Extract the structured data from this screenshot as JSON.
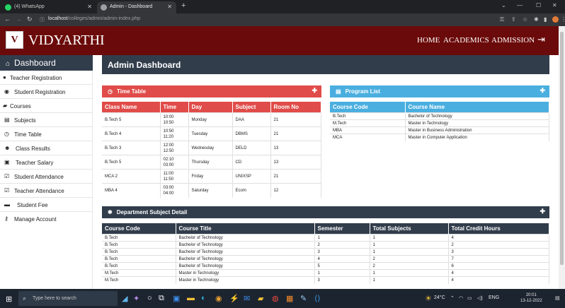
{
  "browser": {
    "tabs": [
      {
        "title": "(4) WhatsApp",
        "active": false
      },
      {
        "title": "Admin - Dashboard",
        "active": true
      }
    ],
    "new_tab": "+",
    "url_host": "localhost",
    "url_path": "/colleges/admin/admin-index.php",
    "window_controls": [
      "⌄",
      "—",
      "☐",
      "✕"
    ]
  },
  "header": {
    "logo_letter": "V",
    "brand": "VIDYARTHI",
    "nav": [
      "HOME",
      "ACADEMICS",
      "ADMISSION"
    ],
    "logout_icon": "sign-out-icon"
  },
  "sidebar": {
    "title": "Dashboard",
    "items": [
      {
        "label": "Teacher Registration",
        "icon": "user-icon"
      },
      {
        "label": "Student Registration",
        "icon": "user-circle-icon"
      },
      {
        "label": "Courses",
        "icon": "book-icon"
      },
      {
        "label": "Subjects",
        "icon": "file-icon"
      },
      {
        "label": "Time Table",
        "icon": "clock-icon"
      },
      {
        "label": "Class Results",
        "icon": "users-icon"
      },
      {
        "label": "Teacher Salary",
        "icon": "money-icon"
      },
      {
        "label": "Student Attendance",
        "icon": "check-square-icon"
      },
      {
        "label": "Teacher Attendance",
        "icon": "checkbox-icon"
      },
      {
        "label": "Student Fee",
        "icon": "credit-card-icon"
      },
      {
        "label": "Manage Account",
        "icon": "key-icon"
      }
    ]
  },
  "main": {
    "title": "Admin Dashboard",
    "timetable": {
      "title": "Time Table",
      "color": "#e04c49",
      "columns": [
        "Class Name",
        "Time",
        "Day",
        "Subject",
        "Room No"
      ],
      "rows": [
        {
          "class": "B.Tech 5",
          "t1": "10:00",
          "t2": "10:50",
          "day": "Monday",
          "subject": "DAA",
          "room": "21"
        },
        {
          "class": "B.Tech 4",
          "t1": "10:50",
          "t2": "11:20",
          "day": "Tuesday",
          "subject": "DBMS",
          "room": "21"
        },
        {
          "class": "B.Tech 3",
          "t1": "12:00",
          "t2": "12:50",
          "day": "Wednesday",
          "subject": "DELD",
          "room": "13"
        },
        {
          "class": "B.Tech 5",
          "t1": "02:10",
          "t2": "03:00",
          "day": "Thursday",
          "subject": "CD",
          "room": "13"
        },
        {
          "class": "MCA 2",
          "t1": "11:00",
          "t2": "11:50",
          "day": "Friday",
          "subject": "UNIXSP",
          "room": "21"
        },
        {
          "class": "MBA 4",
          "t1": "03:00",
          "t2": "04:00",
          "day": "Saturday",
          "subject": "Ecom",
          "room": "12"
        }
      ]
    },
    "programs": {
      "title": "Program List",
      "color": "#4aafe0",
      "columns": [
        "Course Code",
        "Course Name"
      ],
      "rows": [
        {
          "code": "B.Tech",
          "name": "Bachelor of Technology"
        },
        {
          "code": "M.Tech",
          "name": "Master in Technology"
        },
        {
          "code": "MBA",
          "name": "Master in Business Administration"
        },
        {
          "code": "MCA",
          "name": "Master in Computer Application"
        }
      ]
    },
    "dept": {
      "title": "Department Subject Detail",
      "color": "#323d4c",
      "columns": [
        "Course Code",
        "Course Title",
        "Semester",
        "Total Subjects",
        "Total Credit Hours"
      ],
      "rows": [
        {
          "code": "B.Tech",
          "title": "Bachelor of Technology",
          "sem": "1",
          "subjects": "1",
          "credits": "4"
        },
        {
          "code": "B.Tech",
          "title": "Bachelor of Technology",
          "sem": "2",
          "subjects": "1",
          "credits": "2"
        },
        {
          "code": "B.Tech",
          "title": "Bachelor of Technology",
          "sem": "3",
          "subjects": "1",
          "credits": "3"
        },
        {
          "code": "B.Tech",
          "title": "Bachelor of Technology",
          "sem": "4",
          "subjects": "2",
          "credits": "7"
        },
        {
          "code": "B.Tech",
          "title": "Bachelor of Technology",
          "sem": "5",
          "subjects": "2",
          "credits": "6"
        },
        {
          "code": "M.Tech",
          "title": "Master in Technology",
          "sem": "1",
          "subjects": "1",
          "credits": "4"
        },
        {
          "code": "M.Tech",
          "title": "Master in Technology",
          "sem": "3",
          "subjects": "1",
          "credits": "4"
        }
      ]
    }
  },
  "taskbar": {
    "search_placeholder": "Type here to search",
    "weather": "24°C",
    "language": "ENG",
    "time": "20:01",
    "date": "13-12-2022"
  }
}
